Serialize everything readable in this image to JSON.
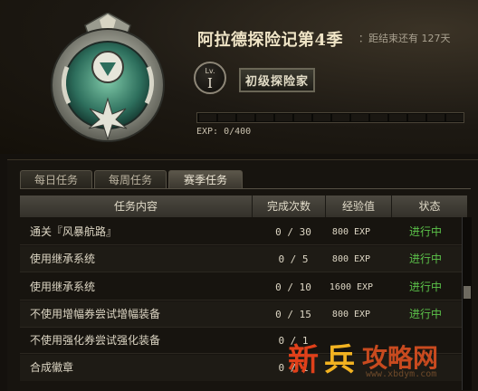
{
  "season": {
    "title": "阿拉德探险记第4季",
    "remaining": "：距结束还有 127天",
    "level_label": "Lv.",
    "level_value": "I",
    "rank_title": "初级探险家",
    "exp_text": "EXP: 0/400",
    "exp_progress": 0
  },
  "tabs": [
    {
      "label": "每日任务",
      "active": false
    },
    {
      "label": "每周任务",
      "active": false
    },
    {
      "label": "赛季任务",
      "active": true
    }
  ],
  "table": {
    "headers": [
      "任务内容",
      "完成次数",
      "经验值",
      "状态"
    ],
    "rows": [
      {
        "name": "通关『风暴航路』",
        "count": "0 / 30",
        "exp": "800 EXP",
        "status": "进行中"
      },
      {
        "name": "使用继承系统",
        "count": "0 / 5",
        "exp": "800 EXP",
        "status": "进行中"
      },
      {
        "name": "使用继承系统",
        "count": "0 / 10",
        "exp": "1600 EXP",
        "status": "进行中"
      },
      {
        "name": "不使用增幅券尝试增幅装备",
        "count": "0 / 15",
        "exp": "800 EXP",
        "status": "进行中"
      },
      {
        "name": "不使用强化券尝试强化装备",
        "count": "0 / 1",
        "exp": "",
        "status": ""
      },
      {
        "name": "合成徽章",
        "count": "0 / 1",
        "exp": "",
        "status": ""
      }
    ]
  },
  "watermark": {
    "xin": "新",
    "bing": "兵",
    "gonglue": "攻略网",
    "url": "www.xbdym.com"
  },
  "colors": {
    "status_green": "#5cc34a",
    "title_cream": "#efe4c6",
    "watermark_red": "#e0401a",
    "watermark_gold": "#f3b321"
  },
  "icons": {
    "emblem": "season-emblem-icon"
  }
}
